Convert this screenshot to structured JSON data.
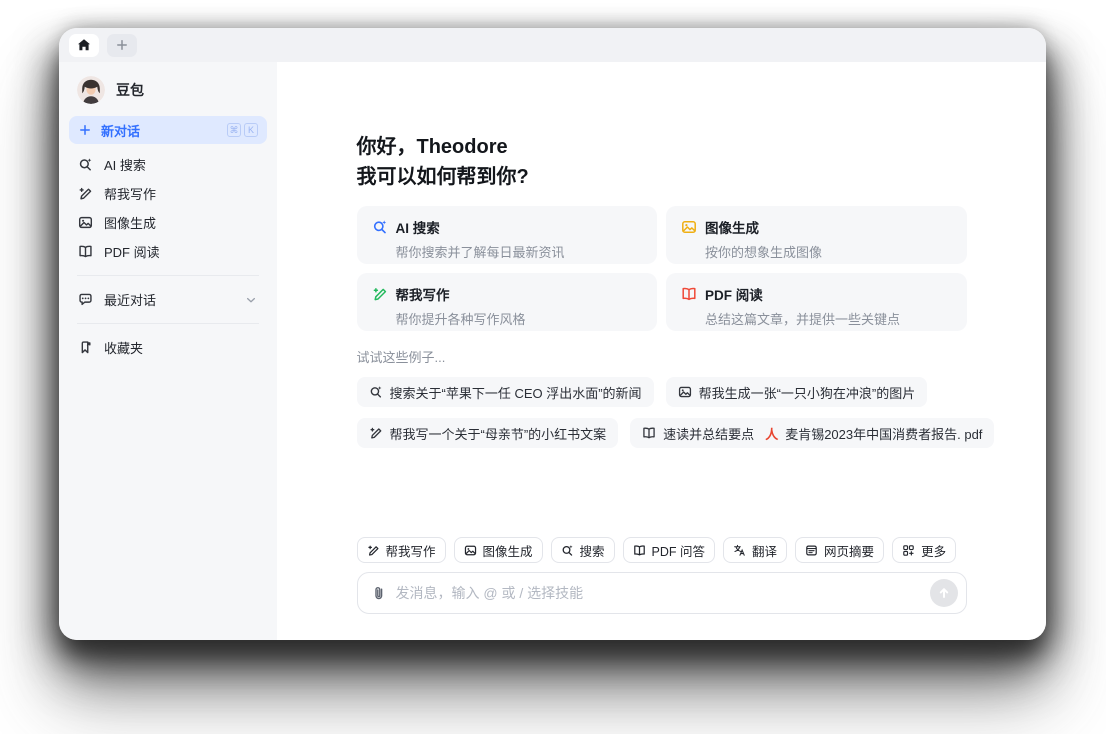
{
  "window": {
    "tabs": {
      "home_tab": "home",
      "new_tab": "plus"
    }
  },
  "sidebar": {
    "profile": {
      "name": "豆包"
    },
    "new_chat": {
      "label": "新对话",
      "shortcut_keys": [
        "⌘",
        "K"
      ]
    },
    "items": [
      {
        "icon": "ai-search-icon",
        "label": "AI 搜索"
      },
      {
        "icon": "write-icon",
        "label": "帮我写作"
      },
      {
        "icon": "image-gen-icon",
        "label": "图像生成"
      },
      {
        "icon": "pdf-read-icon",
        "label": "PDF 阅读"
      }
    ],
    "recent": {
      "label": "最近对话"
    },
    "favorites": {
      "label": "收藏夹"
    }
  },
  "main": {
    "greeting_line1": "你好，Theodore",
    "greeting_line2": "我可以如何帮到你?",
    "cards": [
      {
        "icon": "ai-search-icon",
        "color": "#3370ff",
        "title": "AI 搜索",
        "desc": "帮你搜索并了解每日最新资讯"
      },
      {
        "icon": "image-gen-icon",
        "color": "#efaf13",
        "title": "图像生成",
        "desc": "按你的想象生成图像"
      },
      {
        "icon": "write-icon",
        "color": "#23b95d",
        "title": "帮我写作",
        "desc": "帮你提升各种写作风格"
      },
      {
        "icon": "pdf-read-icon",
        "color": "#ef4938",
        "title": "PDF 阅读",
        "desc": "总结这篇文章，并提供一些关键点"
      }
    ],
    "examples_title": "试试这些例子...",
    "examples": [
      {
        "icon": "ai-search-icon",
        "text": "搜索关于“苹果下一任 CEO 浮出水面”的新闻"
      },
      {
        "icon": "image-gen-icon",
        "text": "帮我生成一张“一只小狗在冲浪”的图片"
      },
      {
        "icon": "write-icon",
        "text": "帮我写一个关于“母亲节”的小红书文案"
      },
      {
        "icon": "pdf-read-icon",
        "text": "速读并总结要点",
        "file_icon": "pdf-file-icon",
        "file": "麦肯锡2023年中国消费者报告. pdf"
      }
    ],
    "skills": [
      {
        "icon": "write-icon",
        "label": "帮我写作"
      },
      {
        "icon": "image-gen-icon",
        "label": "图像生成"
      },
      {
        "icon": "ai-search-icon",
        "label": "搜索"
      },
      {
        "icon": "pdf-read-icon",
        "label": "PDF 问答"
      },
      {
        "icon": "translate-icon",
        "label": "翻译"
      },
      {
        "icon": "webpage-icon",
        "label": "网页摘要"
      },
      {
        "icon": "more-icon",
        "label": "更多"
      }
    ],
    "input": {
      "placeholder": "发消息，输入 @ 或 / 选择技能",
      "send_icon": "arrow-up-icon",
      "attach_icon": "paperclip-icon"
    }
  },
  "colors": {
    "accent": "#3370ff",
    "new_chat_bg": "#dfe9ff",
    "sidebar_bg": "#f6f7f9",
    "card_bg": "#f6f7f9",
    "pdf_red": "#e8442f"
  }
}
